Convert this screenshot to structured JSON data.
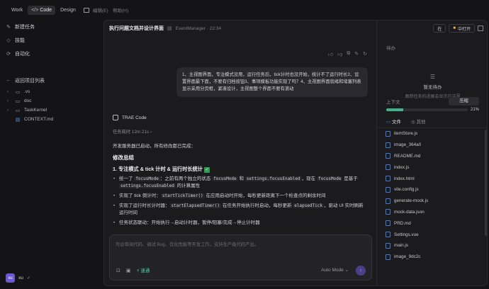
{
  "topbar": {
    "segments": [
      "Work",
      "Code",
      "Design"
    ],
    "menu": [
      "编辑(E)",
      "帮助(H)"
    ]
  },
  "sidebar": {
    "items": [
      "新建任务",
      "技能",
      "自动化"
    ],
    "back": "返回项目列表",
    "tree": [
      ".vs",
      "doc",
      "TaskKernel",
      "CONTEXT.md"
    ]
  },
  "user": {
    "name": "xu",
    "initials": "xu"
  },
  "chat": {
    "title": "执行问题文档并设计界面",
    "subtitle": "EventManager · 22:34",
    "user_message": "1、主视图界面，专注模式没用，运行任务后，tick计时也没开始，统计不了运行时长2、设置界面最下面，不要有归档按钮3、事项模板功能实现了吗？4、主视图界面就绪和堵塞列表显示采用分页框，紧凑设计，主视图整个界面不要有滚动",
    "agent_name": "TRAE Code",
    "elapsed": "任务耗时 12m 21s",
    "intro": "开发服务器已启动，所有修改都已完成：",
    "summary_title": "修改总结",
    "section1_title": "1. 专注模式 & tick 计时 & 运行时长统计",
    "bullets": [
      {
        "a": "统一了 ",
        "c1": "focusMode",
        "b": "：之前有两个独立的状态 ",
        "c2": "focusMode",
        "d": " 和 ",
        "c3": "settings.focusEnabled",
        "e": "，现在 ",
        "c4": "focusMode",
        "f": " 是基于 ",
        "c5": "settings.focusEnabled",
        "g": " 的计算属性"
      },
      {
        "a": "实现了 tick 倒计时：",
        "c1": "startTickTimer()",
        "b": " 在应用启动时开始，每秒更新距离下一个检查点的剩余时间"
      },
      {
        "a": "实现了运行时长计时器：",
        "c1": "startElapsedTimer()",
        "b": " 在任务开始执行时启动，每秒更新 ",
        "c2": "elapsedTick",
        "c": "，驱动 UI 实时刷新运行时间"
      },
      {
        "a": "任务状态联动：开始执行→启动计时器，暂停/阻塞/完成→停止计时器"
      }
    ],
    "input_placeholder": "可@审阅代码、调试 Bug、优化性能等开发工作，支持生产级代码产出。",
    "fast_label": "速通",
    "mode_label": "Auto Mode"
  },
  "right": {
    "open_label": "中打开",
    "pos_label": "在",
    "todo_title": "待办",
    "empty_title": "暂无待办",
    "empty_sub": "跟踪任务的进展会显示在这里",
    "context_label": "上下文",
    "compress_label": "压缩",
    "context_percent": "21%",
    "context_fraction": 0.21,
    "accent": "#3fb38a",
    "tabs": [
      "文件",
      "其他"
    ],
    "files": [
      "itemStore.js",
      "image_364a0",
      "README.md",
      "index.js",
      "index.html",
      "vite.config.js",
      "generate-mock.js",
      "mock-data.json",
      "PRD.md",
      "Settings.vue",
      "main.js",
      "image_9dc2c"
    ]
  }
}
